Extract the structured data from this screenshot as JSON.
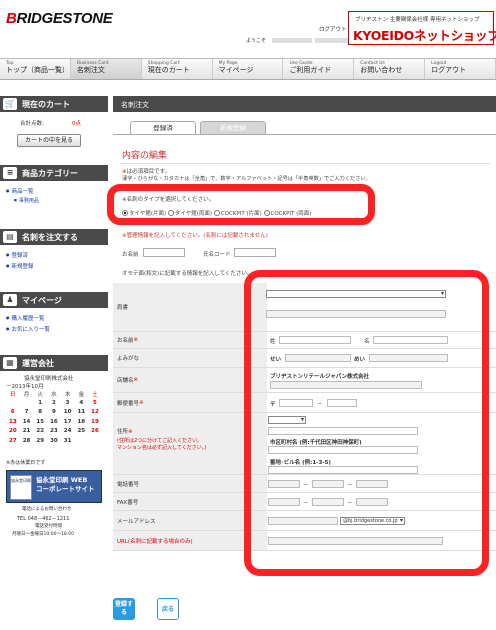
{
  "header": {
    "logo": "BRIDGESTONE",
    "logout": "ログアウト",
    "welcome_prefix": "ようこそ",
    "shop_subtitle": "ブリヂストン 主要関係会社様 専用ネットショップ",
    "shop_name": "KYOEIDOネットショップ"
  },
  "nav": [
    {
      "en": "Top",
      "jp": "トップ（商品一覧）"
    },
    {
      "en": "Business Card",
      "jp": "名刺注文"
    },
    {
      "en": "Shopping Cart",
      "jp": "現在のカート"
    },
    {
      "en": "My Page",
      "jp": "マイページ"
    },
    {
      "en": "Use Guide",
      "jp": "ご利用ガイド"
    },
    {
      "en": "Contact Us",
      "jp": "お問い合わせ"
    },
    {
      "en": "Logout",
      "jp": "ログアウト"
    }
  ],
  "sidebar": {
    "cart_title": "現在のカート",
    "cart_count_label": "合計点数:",
    "cart_count_value": "0点",
    "cart_button": "カートの中を見る",
    "category_title": "商品カテゴリー",
    "category_items": [
      "商品一覧",
      "事務用品"
    ],
    "order_title": "名刺を注文する",
    "order_items": [
      "登録済",
      "新規登録"
    ],
    "mypage_title": "マイページ",
    "mypage_items": [
      "購入履歴一覧",
      "お気に入り一覧"
    ],
    "company_title": "運営会社",
    "company_name": "協永堂印刷株式会社",
    "calendar_title": "－2013年10月",
    "calendar_weekdays": [
      "日",
      "月",
      "火",
      "水",
      "木",
      "金",
      "土"
    ],
    "calendar_rows": [
      [
        "",
        "",
        "1",
        "2",
        "3",
        "4",
        "5"
      ],
      [
        "6",
        "7",
        "8",
        "9",
        "10",
        "11",
        "12"
      ],
      [
        "13",
        "14",
        "15",
        "16",
        "17",
        "18",
        "19"
      ],
      [
        "20",
        "21",
        "22",
        "23",
        "24",
        "25",
        "26"
      ],
      [
        "27",
        "28",
        "29",
        "30",
        "31",
        "",
        ""
      ]
    ],
    "calendar_note": "※赤は休業日です",
    "banner_icon": "協永堂印刷",
    "banner_line1": "協永堂印刷 WEB",
    "banner_line2": "コーポレートサイト",
    "contact_line1": "電話によるお問い合わせ",
    "contact_tel": "TEL 048－462－1211",
    "contact_hours_label": "電話受付時間",
    "contact_hours": "月曜日～金曜日10:00～18:00"
  },
  "main": {
    "bar_title": "名刺注文",
    "tab_registered": "登録済",
    "tab_new": "新規登録",
    "edit_title": "内容の編集",
    "note_required": "※は必須項目です。",
    "note_chars": "漢字・ひらがな・カタカナは「全角」で、数字・アルファベット・記号は「半角英数」でご入力ください。",
    "type_prompt": "※名刺のタイプを選択してください。",
    "type_options": [
      "タイヤ館(片面)",
      "タイヤ館(両面)",
      "COCKPIT (片面)",
      "COCKPIT (両面)"
    ],
    "mgmt_note": "※管理情報を記入してください。(名刺には記載されません)",
    "name_label": "お名前",
    "code_label": "氏名コード",
    "front_note": "オモテ面(和文)に記載する情報を記入してください。",
    "fields": {
      "title": "肩書",
      "name": "お名前",
      "surname": "姓",
      "given": "名",
      "furigana": "よみがな",
      "sei": "せい",
      "mei": "めい",
      "store": "店舗名",
      "store_value": "ブリヂストンリテールジャパン株式会社",
      "postal": "郵便番号",
      "postal_mark": "〒",
      "address": "住所",
      "address_note1": "(住所は2つに分けてご記入ください。",
      "address_note2": "マンション名は必ず記入してください。)",
      "address_example1": "市区町村名 (例:千代田区神田神保町)",
      "address_example2": "番地･ビル名 (例:1-3-5)",
      "tel": "電話番号",
      "fax": "FAX番号",
      "email": "メールアドレス",
      "email_domain": "@bj.bridgestone.co.jp",
      "url": "URL(名刺に記載する場合のみ)",
      "required_mark": "※",
      "dash": "－"
    },
    "btn_register": "登録する",
    "btn_back": "戻る"
  },
  "colors": {
    "accent_red": "#ff2222",
    "dark_bar": "#4a4a4a",
    "button_blue": "#2a9be0"
  }
}
